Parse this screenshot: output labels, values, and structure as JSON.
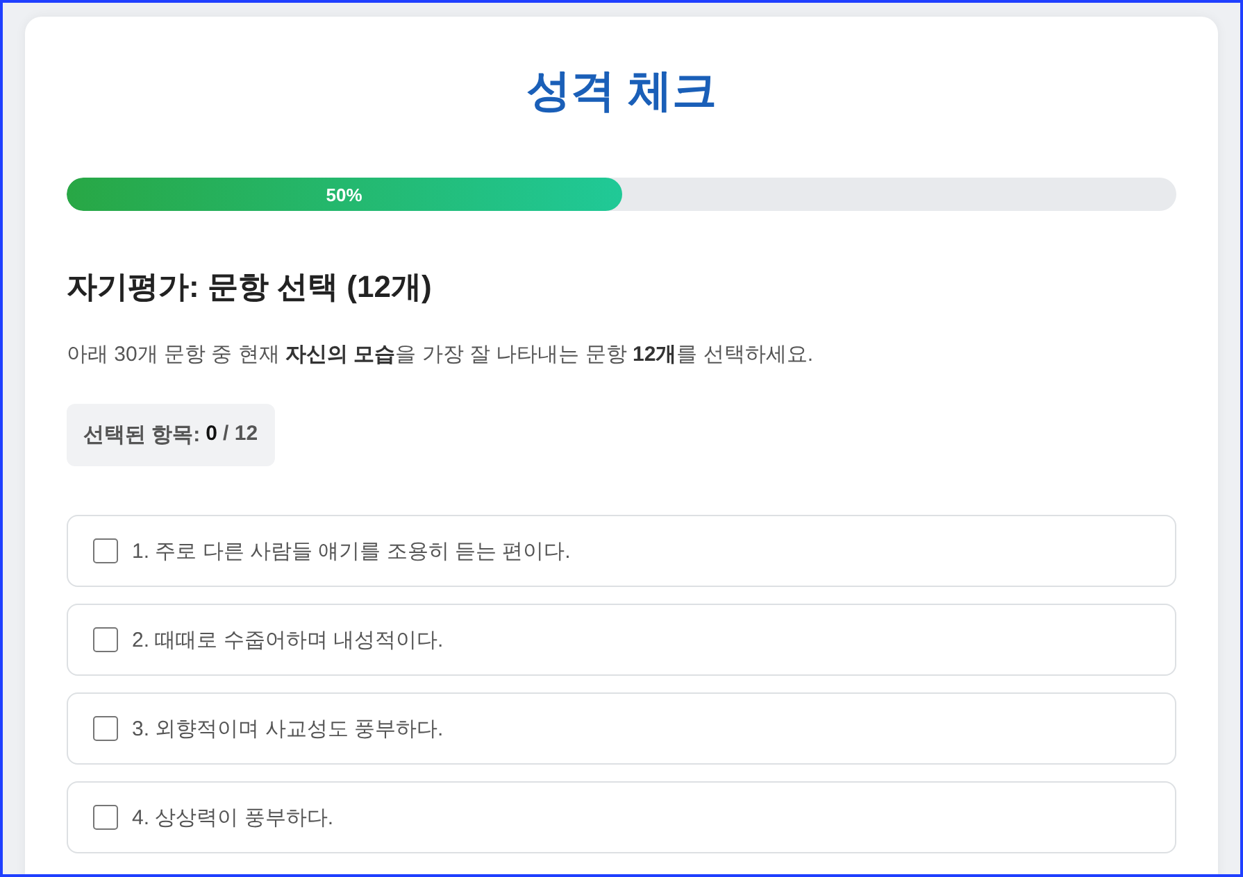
{
  "title": "성격 체크",
  "progress": {
    "level": 0.5,
    "label": "50%"
  },
  "section_heading": "자기평가: 문항 선택 (12개)",
  "instructions": "아래 30개 문항 중 현재 **자신의 모습**을 가장 잘 나타내는 문항 **12개**를 선택하세요.",
  "counter": {
    "label": "선택된 항목:",
    "selected_count": "0",
    "total": "/ 12"
  },
  "items": [
    {
      "label": "1. 주로 다른 사람들 얘기를 조용히 듣는 편이다.",
      "checked": false
    },
    {
      "label": "2. 때때로 수줍어하며 내성적이다.",
      "checked": false
    },
    {
      "label": "3. 외향적이며 사교성도 풍부하다.",
      "checked": false
    },
    {
      "label": "4. 상상력이 풍부하다.",
      "checked": false
    }
  ]
}
